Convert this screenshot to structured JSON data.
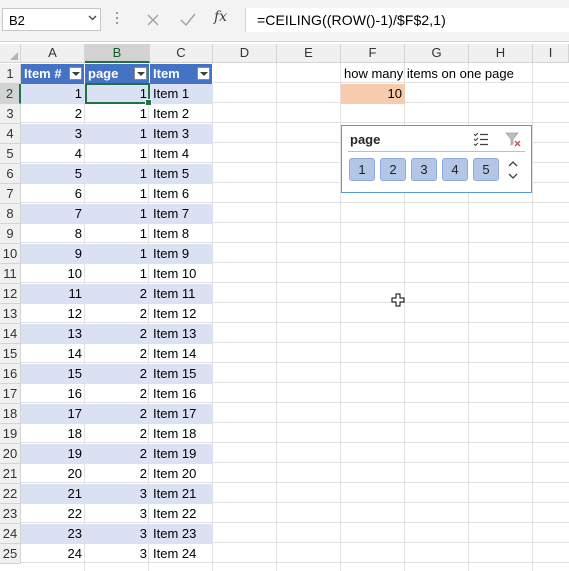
{
  "name_box": "B2",
  "formula": "=CEILING((ROW()-1)/$F$2,1)",
  "fx_label": "fx",
  "column_headers": [
    "A",
    "B",
    "C",
    "D",
    "E",
    "F",
    "G",
    "H",
    "I"
  ],
  "row_numbers": [
    "1",
    "2",
    "3",
    "4",
    "5",
    "6",
    "7",
    "8",
    "9",
    "10",
    "11",
    "12",
    "13",
    "14",
    "15",
    "16",
    "17",
    "18",
    "19",
    "20",
    "21",
    "22",
    "23",
    "24",
    "25"
  ],
  "table": {
    "headers": [
      "Item #",
      "page",
      "Item"
    ],
    "rows": [
      [
        "1",
        "1",
        "Item 1"
      ],
      [
        "2",
        "1",
        "Item 2"
      ],
      [
        "3",
        "1",
        "Item 3"
      ],
      [
        "4",
        "1",
        "Item 4"
      ],
      [
        "5",
        "1",
        "Item 5"
      ],
      [
        "6",
        "1",
        "Item 6"
      ],
      [
        "7",
        "1",
        "Item 7"
      ],
      [
        "8",
        "1",
        "Item 8"
      ],
      [
        "9",
        "1",
        "Item 9"
      ],
      [
        "10",
        "1",
        "Item 10"
      ],
      [
        "11",
        "2",
        "Item 11"
      ],
      [
        "12",
        "2",
        "Item 12"
      ],
      [
        "13",
        "2",
        "Item 13"
      ],
      [
        "14",
        "2",
        "Item 14"
      ],
      [
        "15",
        "2",
        "Item 15"
      ],
      [
        "16",
        "2",
        "Item 16"
      ],
      [
        "17",
        "2",
        "Item 17"
      ],
      [
        "18",
        "2",
        "Item 18"
      ],
      [
        "19",
        "2",
        "Item 19"
      ],
      [
        "20",
        "2",
        "Item 20"
      ],
      [
        "21",
        "3",
        "Item 21"
      ],
      [
        "22",
        "3",
        "Item 22"
      ],
      [
        "23",
        "3",
        "Item 23"
      ],
      [
        "24",
        "3",
        "Item 24"
      ]
    ]
  },
  "f1_label": "how many items on one page",
  "f2_value": "10",
  "slicer": {
    "title": "page",
    "buttons": [
      "1",
      "2",
      "3",
      "4",
      "5"
    ]
  },
  "colors": {
    "header_fill": "#4472c4",
    "band_fill": "#d9e1f2",
    "input_fill": "#f8cbad",
    "selection_green": "#217346",
    "slicer_button": "#b4c6e7"
  }
}
